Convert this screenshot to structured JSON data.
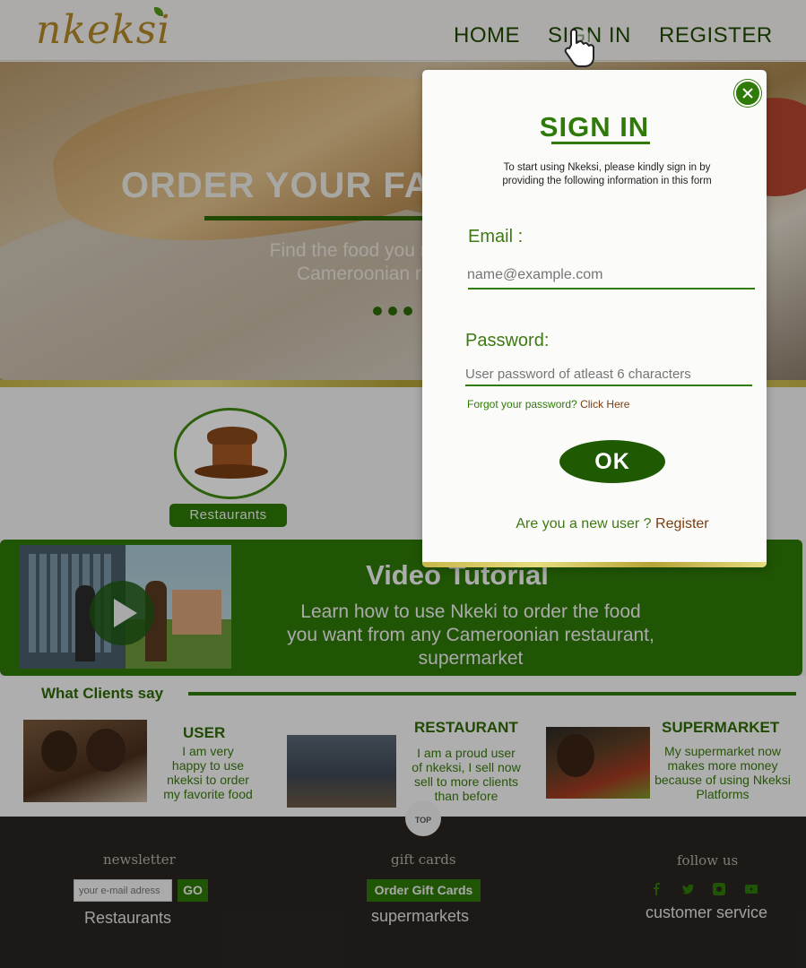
{
  "header": {
    "logo": "nkeksi",
    "nav": {
      "home": "HOME",
      "signin": "SIGN IN",
      "register": "REGISTER"
    }
  },
  "hero": {
    "title": "ORDER YOUR FAVORITE FOOD",
    "subtitle_lines": [
      "Find the food you need from the",
      "Cameroonian restaurants"
    ]
  },
  "categories": {
    "restaurants": "Restaurants"
  },
  "video": {
    "title": "Video Tutorial",
    "desc_lines": [
      "Learn how to use Nkeki to order the food",
      "you want from any Cameroonian restaurant,",
      "supermarket"
    ]
  },
  "clients": {
    "heading": "What Clients say",
    "items": [
      {
        "title": "USER",
        "lines": [
          "I am very",
          "happy to use",
          "nkeksi to order",
          "my favorite food"
        ]
      },
      {
        "title": "RESTAURANT",
        "lines": [
          "I am a proud user",
          "of nkeksi, I sell now",
          "sell to more clients",
          "than before"
        ]
      },
      {
        "title": "SUPERMARKET",
        "lines": [
          "My supermarket now",
          "makes more money",
          "because of using Nkeksi",
          "Platforms"
        ]
      }
    ]
  },
  "top_button": "TOP",
  "footer": {
    "newsletter": {
      "label": "newsletter",
      "input_placeholder": "your e-mail adress",
      "go": "GO",
      "link": "Restaurants"
    },
    "gift": {
      "label": "gift cards",
      "button": "Order Gift Cards",
      "link": "supermarkets"
    },
    "follow": {
      "label": "follow us",
      "link": "customer service",
      "icons": [
        "facebook-icon",
        "twitter-icon",
        "instagram-icon",
        "youtube-icon"
      ]
    }
  },
  "modal": {
    "title": "SIGN IN",
    "intro_lines": [
      "To start using Nkeksi, please kindly sign in by",
      "providing the following information in this form"
    ],
    "email_label": "Email :",
    "email_placeholder": "name@example.com",
    "password_label": "Password:",
    "password_placeholder": "User password of atleast 6 characters",
    "forgot_text": "Forgot your password?",
    "forgot_link": "Click Here",
    "ok": "OK",
    "new_user_text": "Are you a new user ?",
    "register_link": "Register"
  },
  "colors": {
    "brand_green": "#2f7a08",
    "dark_green": "#1f5a02",
    "link_brown": "#7a3c10",
    "footer_bg": "#2a2521"
  }
}
